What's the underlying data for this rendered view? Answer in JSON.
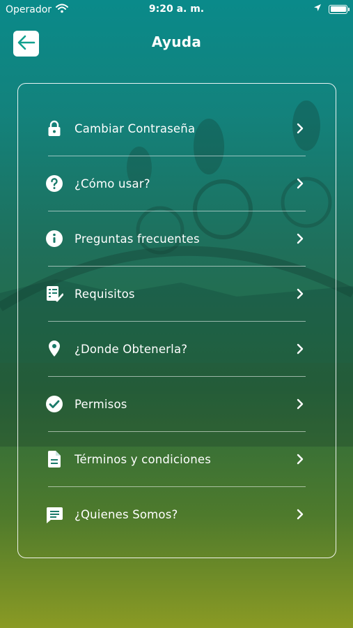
{
  "status_bar": {
    "carrier": "Operador",
    "time": "9:20 a. m."
  },
  "header": {
    "title": "Ayuda",
    "back_icon": "arrow-left-icon"
  },
  "menu": {
    "items": [
      {
        "label": "Cambiar Contraseña",
        "icon": "lock-icon"
      },
      {
        "label": "¿Cómo usar?",
        "icon": "help-circle-icon"
      },
      {
        "label": "Preguntas frecuentes",
        "icon": "info-icon"
      },
      {
        "label": "Requisitos",
        "icon": "checklist-icon"
      },
      {
        "label": "¿Donde Obtenerla?",
        "icon": "location-pin-icon"
      },
      {
        "label": "Permisos",
        "icon": "check-circle-icon"
      },
      {
        "label": "Términos y condiciones",
        "icon": "document-icon"
      },
      {
        "label": "¿Quienes Somos?",
        "icon": "chat-icon"
      }
    ]
  },
  "colors": {
    "gradient_top": "#0a8a8a",
    "gradient_bottom": "#8a9a24",
    "text": "#ffffff",
    "accent": "#12a08f"
  }
}
